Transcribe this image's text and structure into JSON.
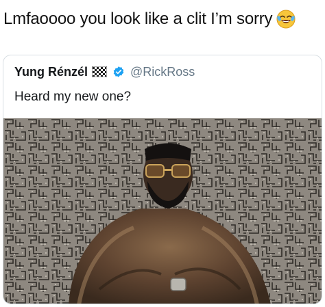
{
  "caption": {
    "text": "Lmfaoooo you look like a clit I’m sorry",
    "emoji_icon": "face-with-tears-of-joy-icon"
  },
  "tweet": {
    "display_name": "Yung Rénzél",
    "flag_icon": "checkered-flag-icon",
    "verified_icon": "verified-badge-icon",
    "handle": "@RickRoss",
    "text": "Heard my new one?",
    "image_icon": "photo-man-in-fur-coat",
    "colors": {
      "verified": "#1da1f2",
      "handle": "#657786",
      "border": "#d7dde2",
      "text": "#14171a"
    }
  }
}
